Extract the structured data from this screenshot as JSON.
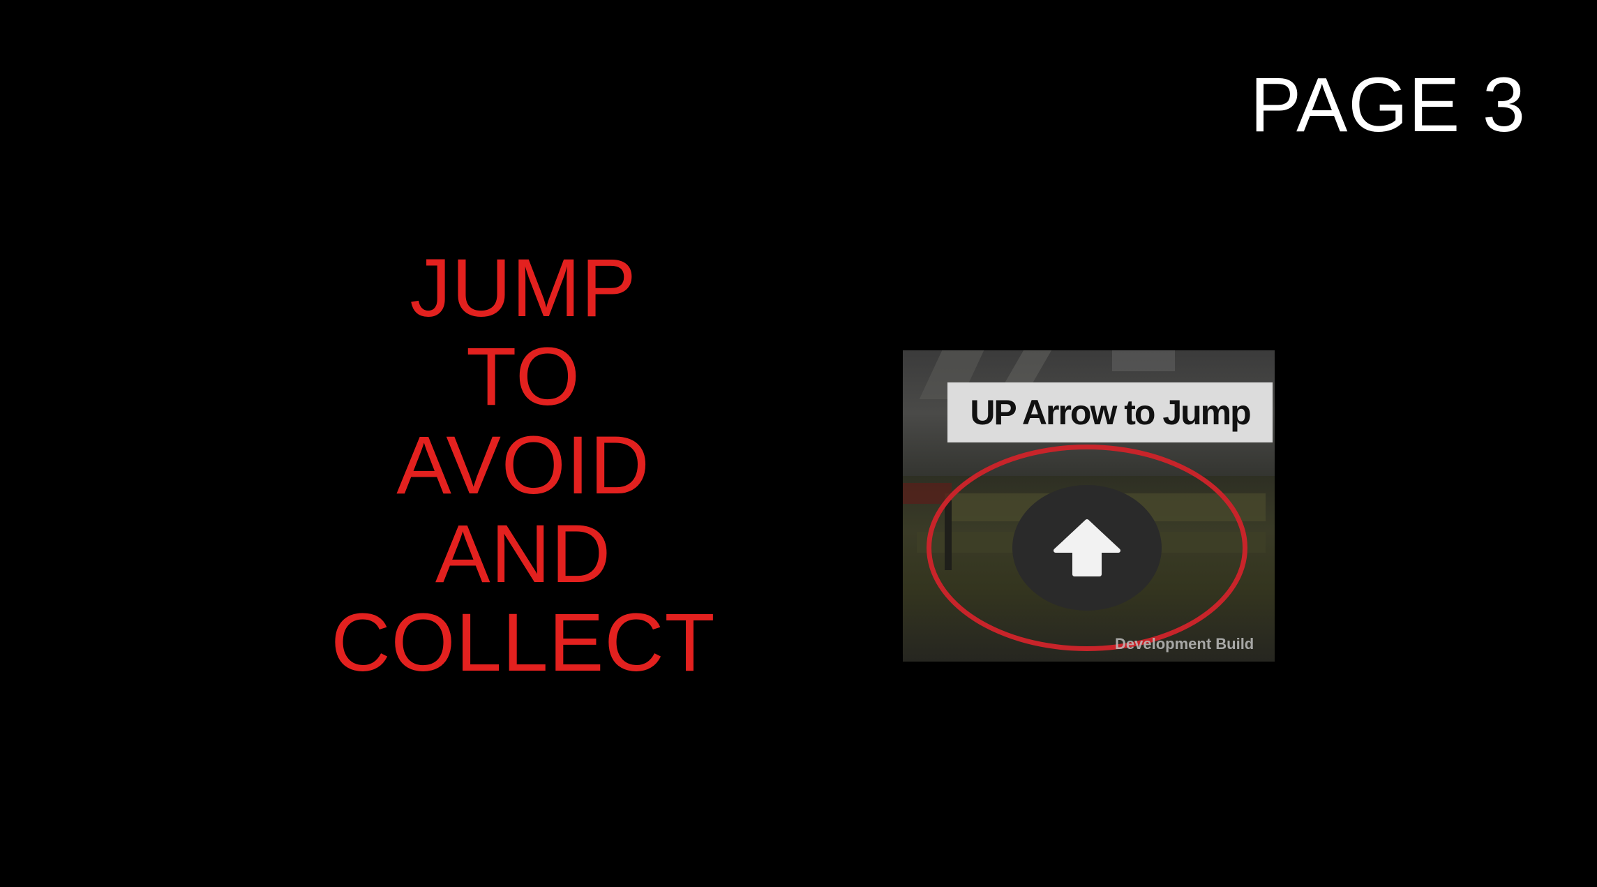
{
  "page_label": "PAGE 3",
  "headline": {
    "lines": [
      "JUMP",
      "TO",
      "AVOID",
      "AND",
      "COLLECT"
    ]
  },
  "thumbnail": {
    "banner_text": "UP Arrow to Jump",
    "button_icon": "up-arrow-icon",
    "footer_text": "Development Build"
  },
  "colors": {
    "background": "#000000",
    "headline": "#e3211f",
    "page_label": "#ffffff",
    "highlight_ring": "#c8242a"
  }
}
